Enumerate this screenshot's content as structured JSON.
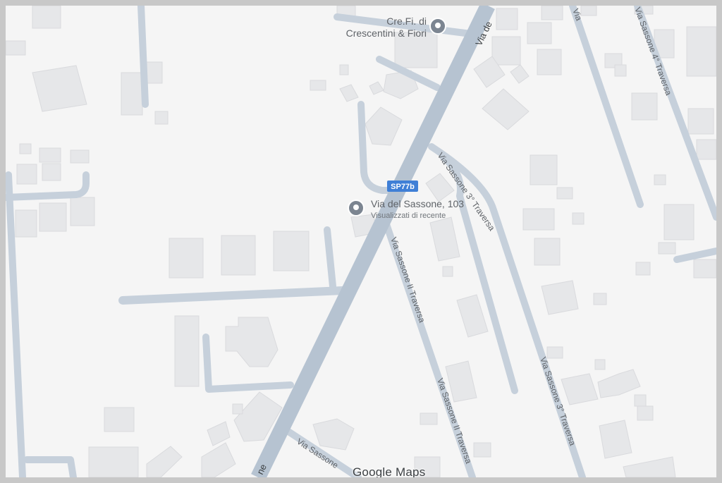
{
  "map": {
    "colors": {
      "background": "#f5f5f5",
      "road": "#c6d0db",
      "main_road": "#b6c3d1",
      "building": "#e6e7e9",
      "shield": "#3f7fd6",
      "pin": "#7c8591"
    },
    "road_shield": {
      "label": "SP77b"
    },
    "streets": {
      "via_del_sassone_top": "Via de",
      "via_del_sassone_bottom": "ne",
      "traversa_3": "Via Sassone 3° Traversa",
      "traversa_2": "Via Sassone II Traversa",
      "traversa_3_lower": "Via Sassone 3° Traversa",
      "traversa_2_lower": "Via Sassone II Traversa",
      "traversa_4": "Via Sassone 4° Traversa",
      "bottom_left_street": "Via Sassone",
      "bottom_traversa_cut": "Via Sassone II Traver"
    },
    "places": [
      {
        "name_line1": "Cre.Fi. di",
        "name_line2": "Crescentini & Fiori",
        "icon": "place-pin-icon"
      },
      {
        "name": "Via del Sassone, 103",
        "subtitle": "Visualizzati di recente",
        "icon": "recent-place-pin-icon"
      }
    ],
    "attribution": {
      "brand": "Google",
      "product": "Maps"
    }
  }
}
